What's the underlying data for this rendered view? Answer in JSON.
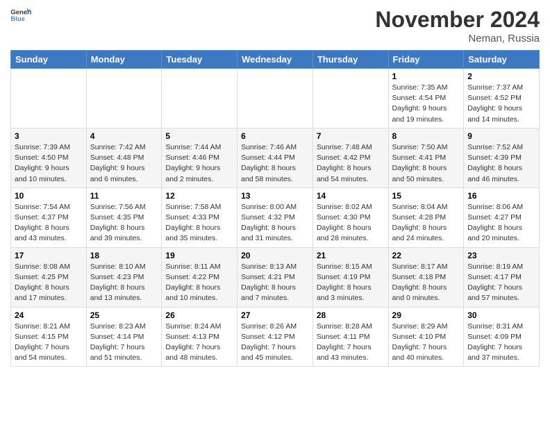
{
  "logo": {
    "general": "General",
    "blue": "Blue"
  },
  "header": {
    "month": "November 2024",
    "location": "Neman, Russia"
  },
  "weekdays": [
    "Sunday",
    "Monday",
    "Tuesday",
    "Wednesday",
    "Thursday",
    "Friday",
    "Saturday"
  ],
  "weeks": [
    [
      {
        "day": "",
        "info": ""
      },
      {
        "day": "",
        "info": ""
      },
      {
        "day": "",
        "info": ""
      },
      {
        "day": "",
        "info": ""
      },
      {
        "day": "",
        "info": ""
      },
      {
        "day": "1",
        "info": "Sunrise: 7:35 AM\nSunset: 4:54 PM\nDaylight: 9 hours\nand 19 minutes."
      },
      {
        "day": "2",
        "info": "Sunrise: 7:37 AM\nSunset: 4:52 PM\nDaylight: 9 hours\nand 14 minutes."
      }
    ],
    [
      {
        "day": "3",
        "info": "Sunrise: 7:39 AM\nSunset: 4:50 PM\nDaylight: 9 hours\nand 10 minutes."
      },
      {
        "day": "4",
        "info": "Sunrise: 7:42 AM\nSunset: 4:48 PM\nDaylight: 9 hours\nand 6 minutes."
      },
      {
        "day": "5",
        "info": "Sunrise: 7:44 AM\nSunset: 4:46 PM\nDaylight: 9 hours\nand 2 minutes."
      },
      {
        "day": "6",
        "info": "Sunrise: 7:46 AM\nSunset: 4:44 PM\nDaylight: 8 hours\nand 58 minutes."
      },
      {
        "day": "7",
        "info": "Sunrise: 7:48 AM\nSunset: 4:42 PM\nDaylight: 8 hours\nand 54 minutes."
      },
      {
        "day": "8",
        "info": "Sunrise: 7:50 AM\nSunset: 4:41 PM\nDaylight: 8 hours\nand 50 minutes."
      },
      {
        "day": "9",
        "info": "Sunrise: 7:52 AM\nSunset: 4:39 PM\nDaylight: 8 hours\nand 46 minutes."
      }
    ],
    [
      {
        "day": "10",
        "info": "Sunrise: 7:54 AM\nSunset: 4:37 PM\nDaylight: 8 hours\nand 43 minutes."
      },
      {
        "day": "11",
        "info": "Sunrise: 7:56 AM\nSunset: 4:35 PM\nDaylight: 8 hours\nand 39 minutes."
      },
      {
        "day": "12",
        "info": "Sunrise: 7:58 AM\nSunset: 4:33 PM\nDaylight: 8 hours\nand 35 minutes."
      },
      {
        "day": "13",
        "info": "Sunrise: 8:00 AM\nSunset: 4:32 PM\nDaylight: 8 hours\nand 31 minutes."
      },
      {
        "day": "14",
        "info": "Sunrise: 8:02 AM\nSunset: 4:30 PM\nDaylight: 8 hours\nand 28 minutes."
      },
      {
        "day": "15",
        "info": "Sunrise: 8:04 AM\nSunset: 4:28 PM\nDaylight: 8 hours\nand 24 minutes."
      },
      {
        "day": "16",
        "info": "Sunrise: 8:06 AM\nSunset: 4:27 PM\nDaylight: 8 hours\nand 20 minutes."
      }
    ],
    [
      {
        "day": "17",
        "info": "Sunrise: 8:08 AM\nSunset: 4:25 PM\nDaylight: 8 hours\nand 17 minutes."
      },
      {
        "day": "18",
        "info": "Sunrise: 8:10 AM\nSunset: 4:23 PM\nDaylight: 8 hours\nand 13 minutes."
      },
      {
        "day": "19",
        "info": "Sunrise: 8:11 AM\nSunset: 4:22 PM\nDaylight: 8 hours\nand 10 minutes."
      },
      {
        "day": "20",
        "info": "Sunrise: 8:13 AM\nSunset: 4:21 PM\nDaylight: 8 hours\nand 7 minutes."
      },
      {
        "day": "21",
        "info": "Sunrise: 8:15 AM\nSunset: 4:19 PM\nDaylight: 8 hours\nand 3 minutes."
      },
      {
        "day": "22",
        "info": "Sunrise: 8:17 AM\nSunset: 4:18 PM\nDaylight: 8 hours\nand 0 minutes."
      },
      {
        "day": "23",
        "info": "Sunrise: 8:19 AM\nSunset: 4:17 PM\nDaylight: 7 hours\nand 57 minutes."
      }
    ],
    [
      {
        "day": "24",
        "info": "Sunrise: 8:21 AM\nSunset: 4:15 PM\nDaylight: 7 hours\nand 54 minutes."
      },
      {
        "day": "25",
        "info": "Sunrise: 8:23 AM\nSunset: 4:14 PM\nDaylight: 7 hours\nand 51 minutes."
      },
      {
        "day": "26",
        "info": "Sunrise: 8:24 AM\nSunset: 4:13 PM\nDaylight: 7 hours\nand 48 minutes."
      },
      {
        "day": "27",
        "info": "Sunrise: 8:26 AM\nSunset: 4:12 PM\nDaylight: 7 hours\nand 45 minutes."
      },
      {
        "day": "28",
        "info": "Sunrise: 8:28 AM\nSunset: 4:11 PM\nDaylight: 7 hours\nand 43 minutes."
      },
      {
        "day": "29",
        "info": "Sunrise: 8:29 AM\nSunset: 4:10 PM\nDaylight: 7 hours\nand 40 minutes."
      },
      {
        "day": "30",
        "info": "Sunrise: 8:31 AM\nSunset: 4:09 PM\nDaylight: 7 hours\nand 37 minutes."
      }
    ]
  ]
}
